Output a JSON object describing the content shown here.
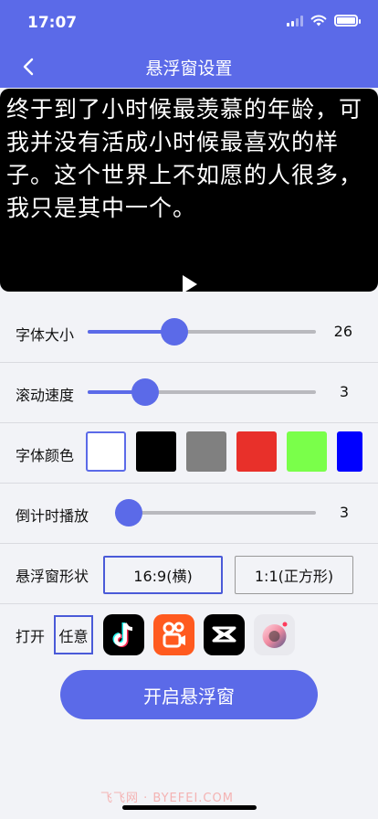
{
  "status_bar": {
    "time": "17:07"
  },
  "nav": {
    "title": "悬浮窗设置",
    "back_icon": "chevron-left-icon"
  },
  "preview": {
    "text": "终于到了小时候最羡慕的年龄，可我并没有活成小时候最喜欢的样子。这个世界上不如愿的人很多，我只是其中一个。",
    "play_icon": "play-icon"
  },
  "font_size": {
    "label": "字体大小",
    "value": "26",
    "fraction": 0.38
  },
  "scroll_speed": {
    "label": "滚动速度",
    "value": "3",
    "fraction": 0.25
  },
  "font_color": {
    "label": "字体颜色",
    "swatches": [
      "#ffffff",
      "#000000",
      "#808080",
      "#e8302a",
      "#7aff4a",
      "#0000ff"
    ],
    "selected": "#ffffff"
  },
  "countdown": {
    "label": "倒计时播放",
    "value": "3",
    "fraction": 0.0
  },
  "window_shape": {
    "label": "悬浮窗形状",
    "options": [
      "16:9(横)",
      "1:1(正方形)"
    ],
    "selected": "16:9(横)"
  },
  "open_with": {
    "label": "打开",
    "any_label": "任意",
    "apps": [
      "tiktok-app-icon",
      "kuaishou-app-icon",
      "capcut-app-icon",
      "camera-app-icon"
    ]
  },
  "start_button": {
    "label": "开启悬浮窗"
  },
  "colors": {
    "accent": "#5b6ae8",
    "background": "#f2f3f7"
  }
}
